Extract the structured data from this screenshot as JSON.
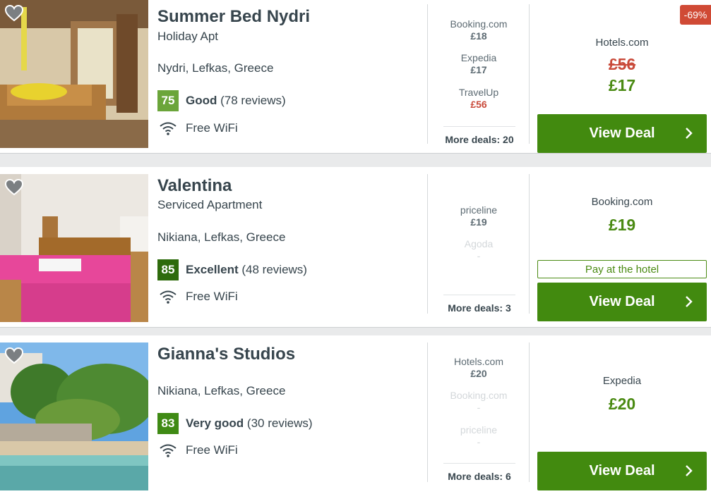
{
  "hotels": [
    {
      "name": "Summer Bed Nydri",
      "type": "Holiday Apt",
      "location": "Nydri, Lefkas, Greece",
      "score": "75",
      "score_color": "#6ba53a",
      "rating_label": "Good",
      "reviews": "(78 reviews)",
      "amenity": "Free WiFi",
      "deals": [
        {
          "provider": "Booking.com",
          "price": "£18"
        },
        {
          "provider": "Expedia",
          "price": "£17"
        },
        {
          "provider": "TravelUp",
          "price": "£56"
        }
      ],
      "more_deals": "More deals: 20",
      "discount": "-69%",
      "best_provider": "Hotels.com",
      "old_price": "£56",
      "best_price": "£17",
      "cta": "View Deal"
    },
    {
      "name": "Valentina",
      "type": "Serviced Apartment",
      "location": "Nikiana, Lefkas, Greece",
      "score": "85",
      "score_color": "#2e6b0c",
      "rating_label": "Excellent",
      "reviews": "(48 reviews)",
      "amenity": "Free WiFi",
      "deals": [
        {
          "provider": "priceline",
          "price": "£19"
        },
        {
          "provider": "Agoda",
          "price": "-"
        }
      ],
      "more_deals": "More deals: 3",
      "best_provider": "Booking.com",
      "best_price": "£19",
      "pay_at_hotel": "Pay at the hotel",
      "cta": "View Deal"
    },
    {
      "name": "Gianna's Studios",
      "location": "Nikiana, Lefkas, Greece",
      "score": "83",
      "score_color": "#3f8a14",
      "rating_label": "Very good",
      "reviews": "(30 reviews)",
      "amenity": "Free WiFi",
      "deals": [
        {
          "provider": "Hotels.com",
          "price": "£20"
        },
        {
          "provider": "Booking.com",
          "price": "-"
        },
        {
          "provider": "priceline",
          "price": "-"
        }
      ],
      "more_deals": "More deals: 6",
      "best_provider": "Expedia",
      "best_price": "£20",
      "cta": "View Deal"
    }
  ],
  "colors": {
    "cta_green": "#428a0f",
    "price_green": "#4a8a12",
    "strike_red": "#c94a3a",
    "discount_red": "#d04a35"
  },
  "icons": [
    "heart-icon",
    "wifi-icon",
    "chevron-right-icon"
  ]
}
